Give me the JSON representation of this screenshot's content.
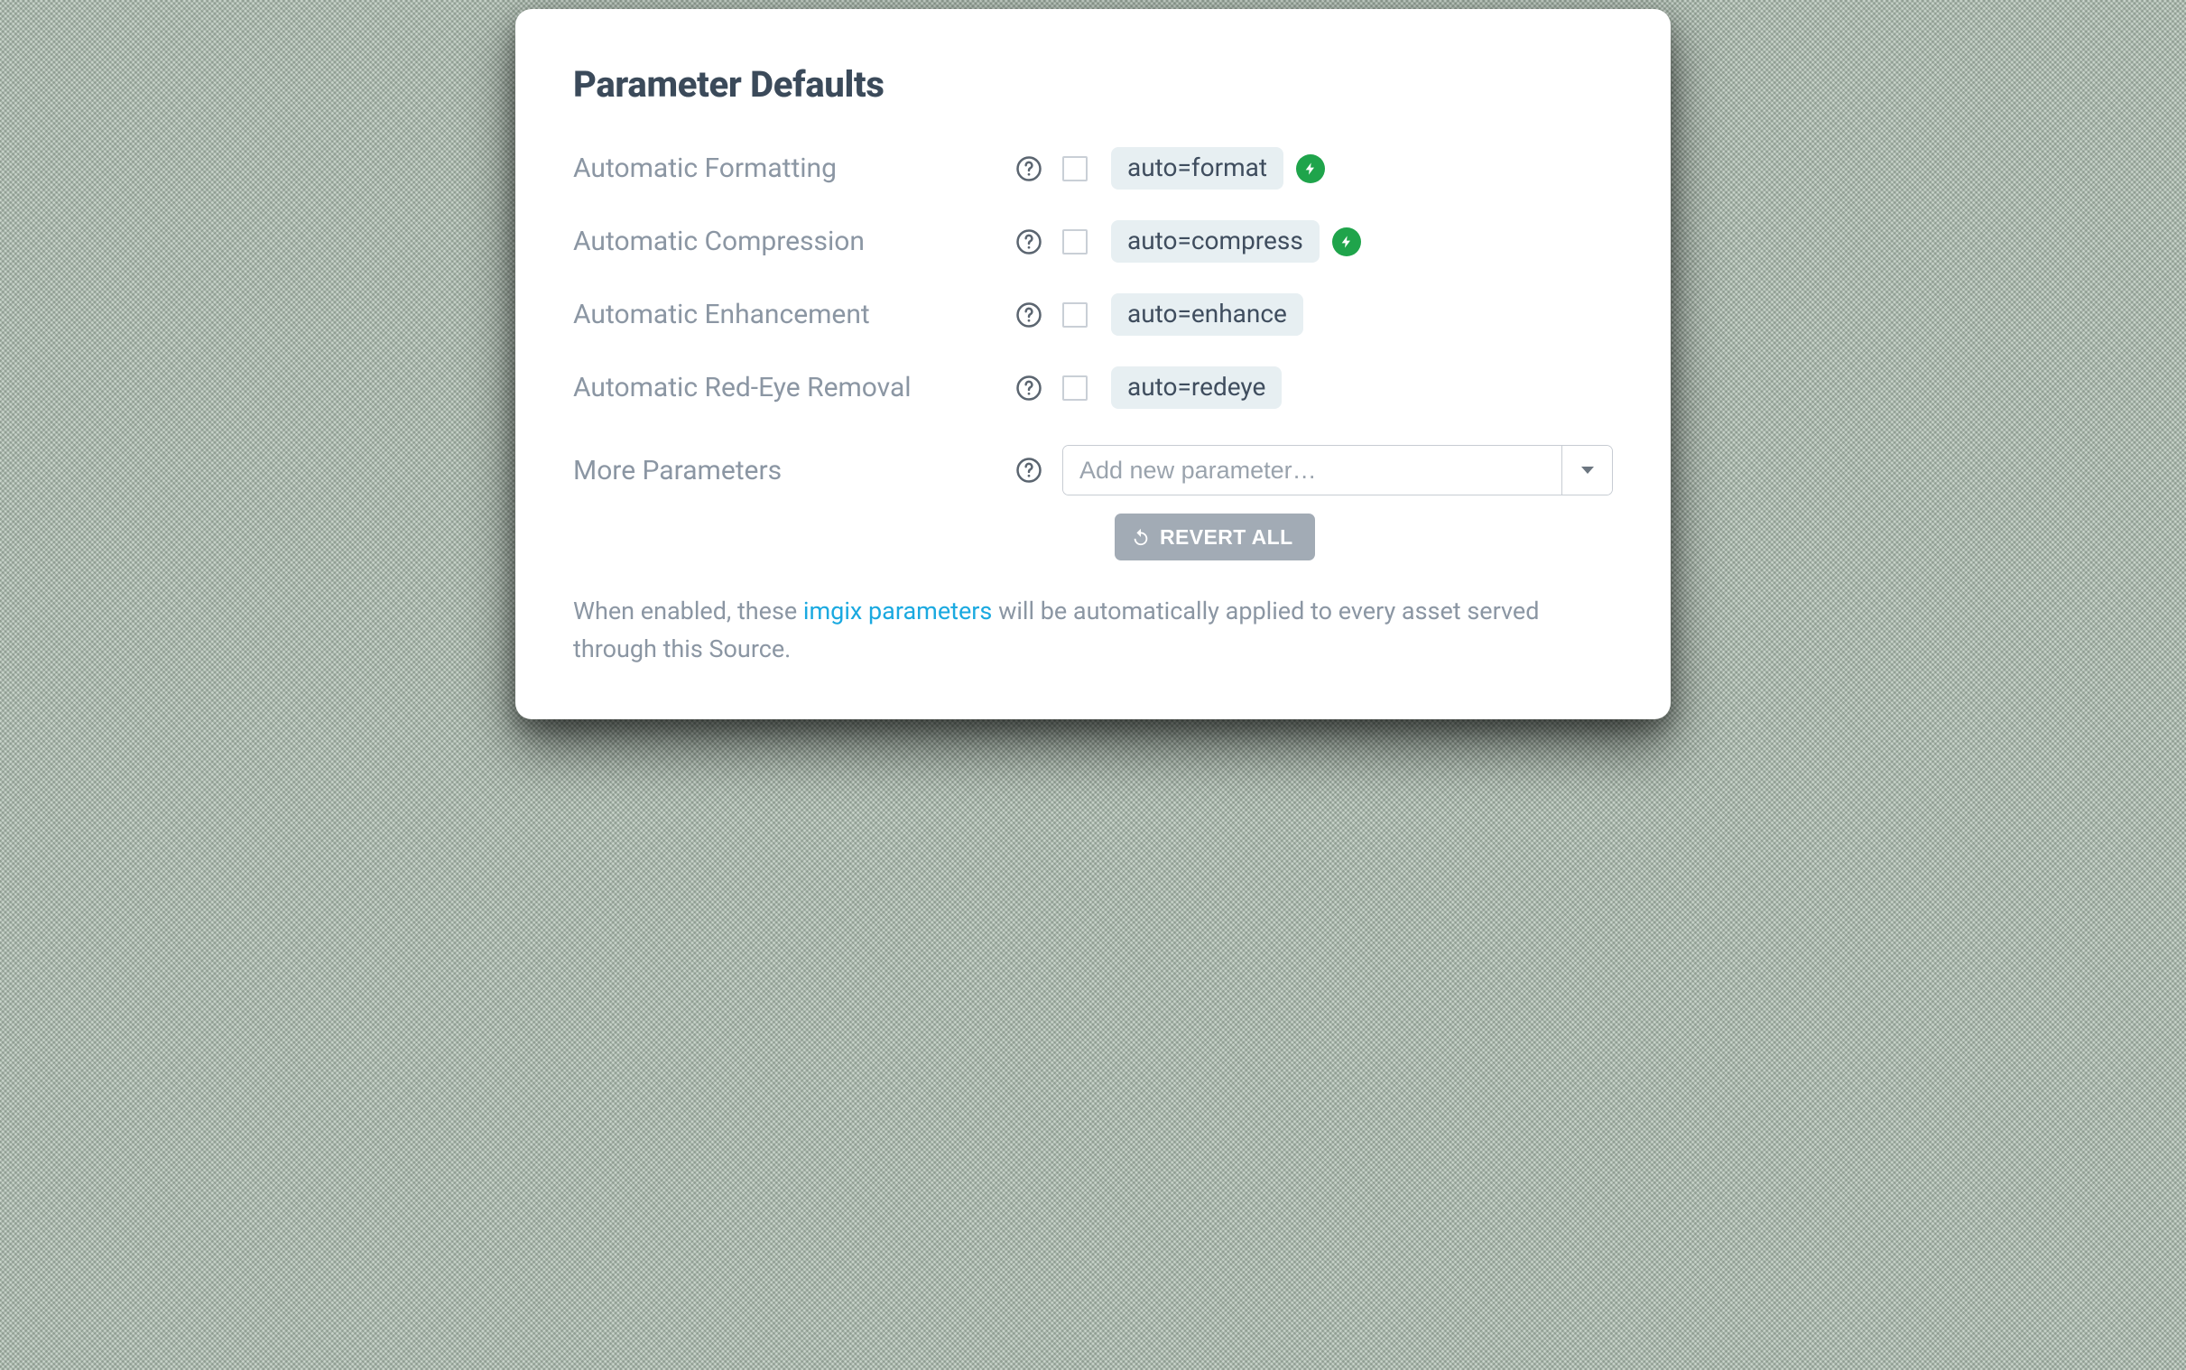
{
  "title": "Parameter Defaults",
  "params": [
    {
      "label": "Automatic Formatting",
      "tag": "auto=format",
      "bolt": true
    },
    {
      "label": "Automatic Compression",
      "tag": "auto=compress",
      "bolt": true
    },
    {
      "label": "Automatic Enhancement",
      "tag": "auto=enhance",
      "bolt": false
    },
    {
      "label": "Automatic Red-Eye Removal",
      "tag": "auto=redeye",
      "bolt": false
    }
  ],
  "more": {
    "label": "More Parameters",
    "placeholder": "Add new parameter…"
  },
  "revert_label": "REVERT ALL",
  "desc": {
    "pre": "When enabled, these ",
    "link": "imgix parameters",
    "post": " will be automatically applied to every asset served through this Source."
  }
}
